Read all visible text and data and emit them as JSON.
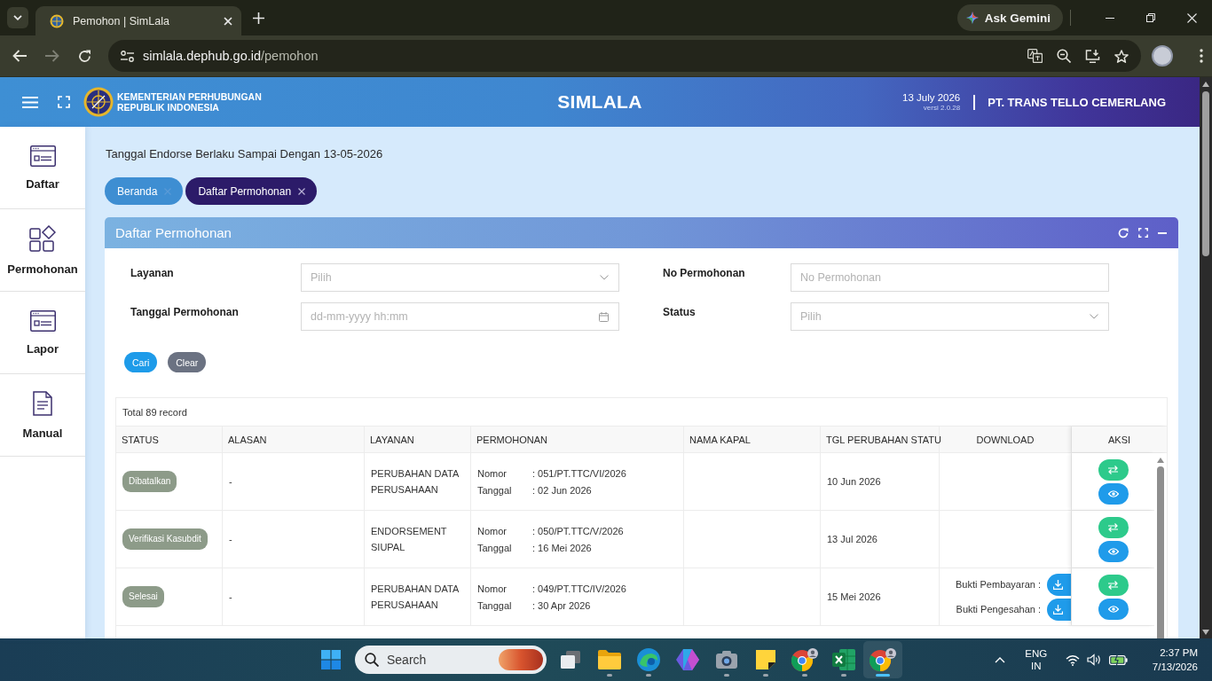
{
  "browser": {
    "tab": {
      "title": "Pemohon | SimLala",
      "selected": true
    },
    "assistant": "Ask Gemini",
    "forward_disabled": true,
    "url": {
      "host": "simlala.dephub.go.id",
      "path": "/pemohon"
    }
  },
  "header": {
    "org_lines": [
      "KEMENTERIAN PERHUBUNGAN",
      "REPUBLIK INDONESIA"
    ],
    "app_title": "SIMLALA",
    "date": "13 July 2026",
    "version": "versi 2.0.28",
    "company": "PT. TRANS TELLO CEMERLANG"
  },
  "sidebar": {
    "items": [
      {
        "label": "Daftar",
        "kind": "form",
        "selected": false
      },
      {
        "label": "Permohonan",
        "kind": "apps",
        "selected": false
      },
      {
        "label": "Lapor",
        "kind": "form",
        "selected": false
      },
      {
        "label": "Manual",
        "kind": "document",
        "selected": false
      }
    ]
  },
  "notice": "Tanggal Endorse Berlaku Sampai Dengan 13-05-2026",
  "tabs": [
    {
      "label": "Beranda",
      "selected": false
    },
    {
      "label": "Daftar Permohonan",
      "selected": true
    }
  ],
  "panel": {
    "title": "Daftar Permohonan"
  },
  "filters": [
    {
      "label": "Layanan",
      "kind": "select",
      "placeholder": "Pilih"
    },
    {
      "label": "No Permohonan",
      "kind": "text",
      "placeholder": "No Permohonan"
    },
    {
      "label": "Tanggal Permohonan",
      "kind": "date",
      "placeholder": "dd-mm-yyyy hh:mm"
    },
    {
      "label": "Status",
      "kind": "select",
      "placeholder": "Pilih"
    }
  ],
  "buttons": [
    {
      "label": "Cari",
      "kind": "primary"
    },
    {
      "label": "Clear",
      "kind": "secondary"
    }
  ],
  "table": {
    "total": "Total 89 record",
    "columns": [
      "STATUS",
      "ALASAN",
      "LAYANAN",
      "PERMOHONAN",
      "NAMA KAPAL",
      "TGL PERUBAHAN STATU",
      "DOWNLOAD",
      "AKSI"
    ],
    "rows": [
      {
        "status": "Dibatalkan",
        "alasan": "-",
        "layanan": "PERUBAHAN DATA PERUSAHAAN",
        "permohonan": [
          {
            "label": "Nomor",
            "value": ": 051/PT.TTC/VI/2026"
          },
          {
            "label": "Tanggal",
            "value": ": 02 Jun 2026"
          }
        ],
        "tgl_perubahan_status": "10 Jun 2026"
      },
      {
        "status": "Verifikasi Kasubdit",
        "alasan": "-",
        "layanan": "ENDORSEMENT SIUPAL",
        "permohonan": [
          {
            "label": "Nomor",
            "value": ": 050/PT.TTC/V/2026"
          },
          {
            "label": "Tanggal",
            "value": ": 16 Mei 2026"
          }
        ],
        "tgl_perubahan_status": "13 Jul 2026"
      },
      {
        "status": "Selesai",
        "alasan": "-",
        "layanan": "PERUBAHAN DATA PERUSAHAAN",
        "permohonan": [
          {
            "label": "Nomor",
            "value": ": 049/PT.TTC/IV/2026"
          },
          {
            "label": "Tanggal",
            "value": ": 30 Apr 2026"
          }
        ],
        "tgl_perubahan_status": "15 Mei 2026",
        "downloads": [
          {
            "label": "Bukti Pembayaran :"
          },
          {
            "label": "Bukti Pengesahan :"
          }
        ]
      }
    ]
  },
  "taskbar": {
    "search": {
      "placeholder": "Search"
    },
    "apps": [
      {
        "kind": "task-view",
        "running": false,
        "selected": false
      },
      {
        "kind": "folder",
        "running": true,
        "selected": false
      },
      {
        "kind": "wave",
        "running": true,
        "selected": false
      },
      {
        "kind": "ribbon",
        "running": false,
        "selected": false
      },
      {
        "kind": "camera",
        "running": true,
        "selected": false
      },
      {
        "kind": "note",
        "running": true,
        "selected": false
      },
      {
        "kind": "browser",
        "running": true,
        "selected": false
      },
      {
        "kind": "spreadsheet",
        "running": true,
        "selected": false
      },
      {
        "kind": "browser",
        "running": true,
        "selected": true
      }
    ],
    "language": {
      "code": "ENG",
      "region": "IN"
    },
    "time": "2:37 PM",
    "date": "7/13/2026"
  }
}
